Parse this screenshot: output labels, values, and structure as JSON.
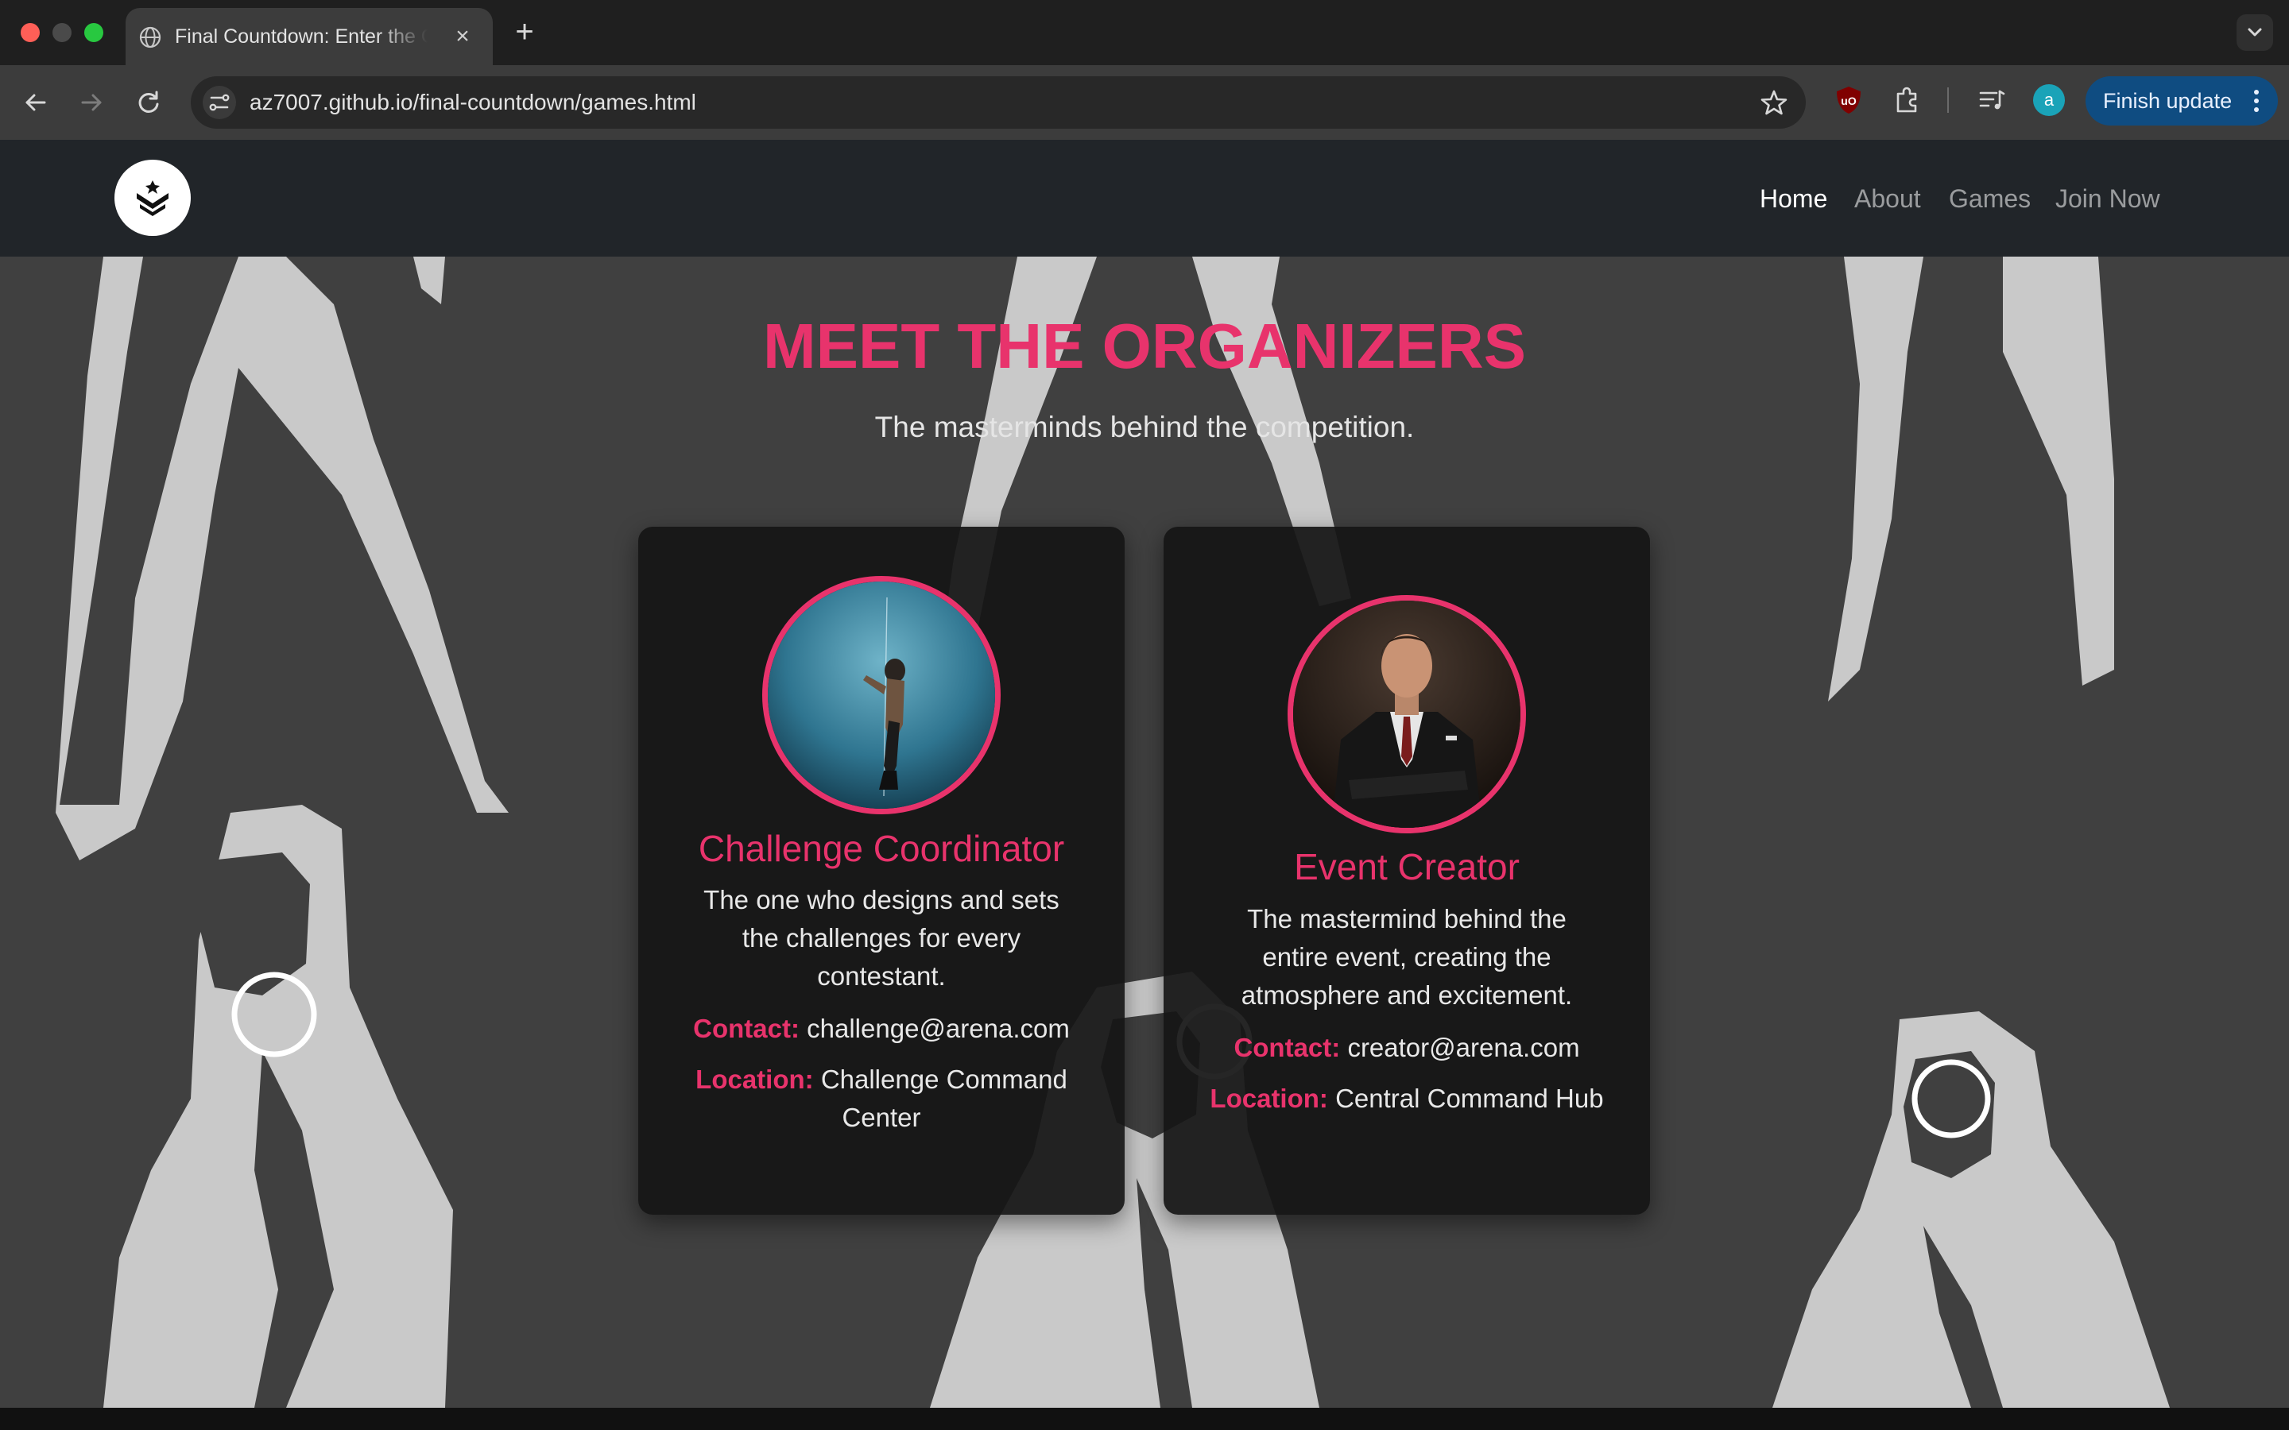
{
  "browser": {
    "tab_title": "Final Countdown: Enter the Games",
    "tab_close_glyph": "×",
    "new_tab_glyph": "+",
    "url": "az7007.github.io/final-countdown/games.html",
    "profile_initial": "a",
    "finish_update_label": "Finish update",
    "accent": "#0f4c81",
    "icons": [
      "globe-icon",
      "back-icon",
      "forward-icon",
      "reload-icon",
      "site-info-icon",
      "star-icon",
      "ublock-icon",
      "puzzle-icon",
      "media-control-icon",
      "kebab-icon",
      "chevron-down-icon"
    ]
  },
  "site": {
    "nav": {
      "links": [
        "Home",
        "About",
        "Games",
        "Join Now"
      ],
      "active": "Home"
    },
    "section": {
      "title": "MEET THE ORGANIZERS",
      "subtitle": "The masterminds behind the competition."
    },
    "accent_color": "#e8336c",
    "organizers": [
      {
        "title": "Challenge Coordinator",
        "description": "The one who designs and sets the challenges for every contestant.",
        "contact_label": "Contact:",
        "contact": "challenge@arena.com",
        "location_label": "Location:",
        "location": "Challenge Command Center"
      },
      {
        "title": "Event Creator",
        "description": "The mastermind behind the entire event, creating the atmosphere and excitement.",
        "contact_label": "Contact:",
        "contact": "creator@arena.com",
        "location_label": "Location:",
        "location": "Central Command Hub"
      }
    ]
  }
}
